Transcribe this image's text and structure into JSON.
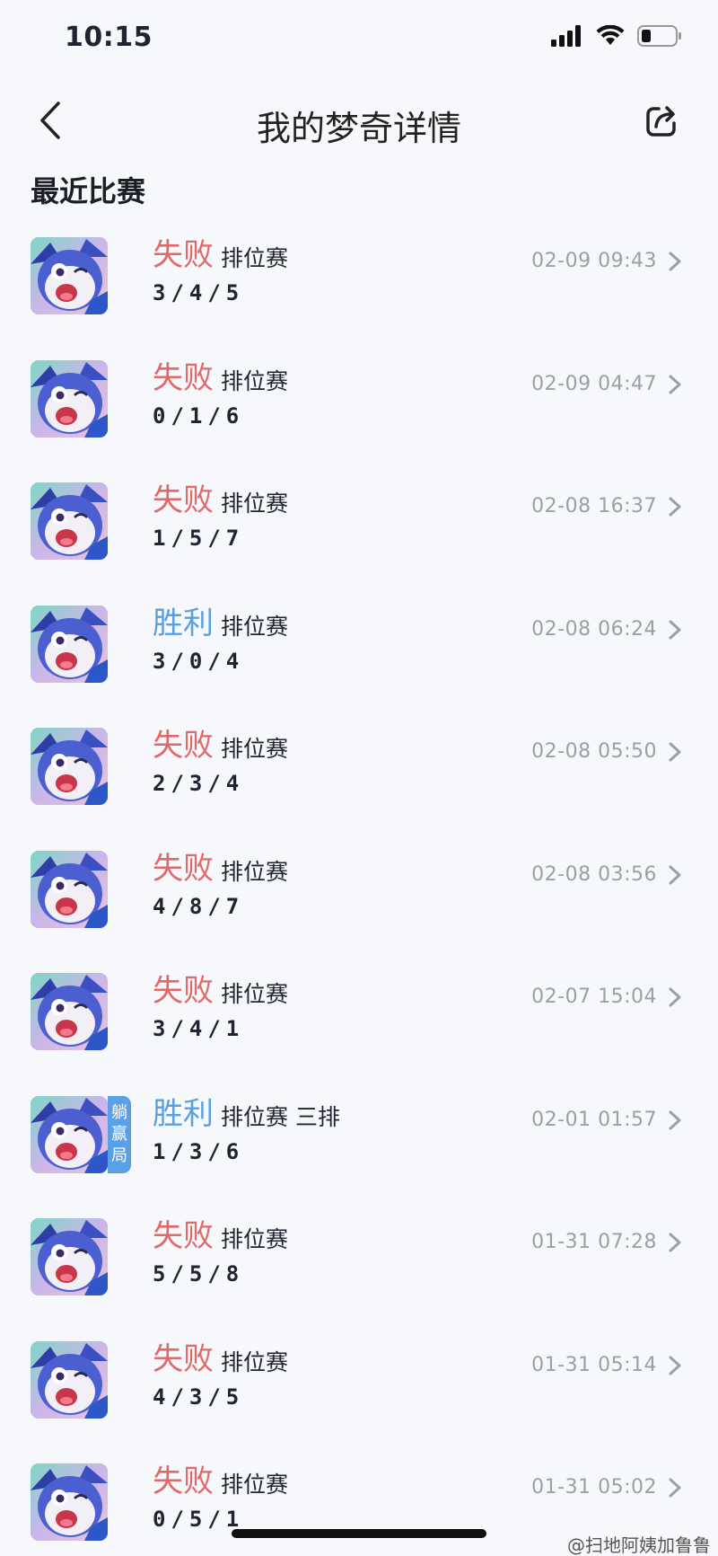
{
  "status_bar": {
    "time": "10:15"
  },
  "nav": {
    "title": "我的梦奇详情"
  },
  "section": {
    "title": "最近比赛"
  },
  "matches": [
    {
      "result": "失败",
      "result_type": "lose",
      "mode": "排位赛",
      "kda": "3/4/5",
      "time": "02-09 09:43",
      "badge": null
    },
    {
      "result": "失败",
      "result_type": "lose",
      "mode": "排位赛",
      "kda": "0/1/6",
      "time": "02-09 04:47",
      "badge": null
    },
    {
      "result": "失败",
      "result_type": "lose",
      "mode": "排位赛",
      "kda": "1/5/7",
      "time": "02-08 16:37",
      "badge": null
    },
    {
      "result": "胜利",
      "result_type": "win",
      "mode": "排位赛",
      "kda": "3/0/4",
      "time": "02-08 06:24",
      "badge": null
    },
    {
      "result": "失败",
      "result_type": "lose",
      "mode": "排位赛",
      "kda": "2/3/4",
      "time": "02-08 05:50",
      "badge": null
    },
    {
      "result": "失败",
      "result_type": "lose",
      "mode": "排位赛",
      "kda": "4/8/7",
      "time": "02-08 03:56",
      "badge": null
    },
    {
      "result": "失败",
      "result_type": "lose",
      "mode": "排位赛",
      "kda": "3/4/1",
      "time": "02-07 15:04",
      "badge": null
    },
    {
      "result": "胜利",
      "result_type": "win",
      "mode": "排位赛 三排",
      "kda": "1/3/6",
      "time": "02-01 01:57",
      "badge": "躺赢局"
    },
    {
      "result": "失败",
      "result_type": "lose",
      "mode": "排位赛",
      "kda": "5/5/8",
      "time": "01-31 07:28",
      "badge": null
    },
    {
      "result": "失败",
      "result_type": "lose",
      "mode": "排位赛",
      "kda": "4/3/5",
      "time": "01-31 05:14",
      "badge": null
    },
    {
      "result": "失败",
      "result_type": "lose",
      "mode": "排位赛",
      "kda": "0/5/1",
      "time": "01-31 05:02",
      "badge": null
    }
  ],
  "watermark": "@扫地阿姨加鲁鲁",
  "colors": {
    "lose": "#e06a6a",
    "win": "#5a9fe0",
    "badge_bg": "#5aa0e6",
    "background": "#f6f8fb"
  },
  "icons": {
    "back": "chevron-left-icon",
    "share": "share-icon",
    "row_arrow": "chevron-right-icon",
    "signal": "signal-icon",
    "wifi": "wifi-icon",
    "battery": "battery-icon"
  }
}
